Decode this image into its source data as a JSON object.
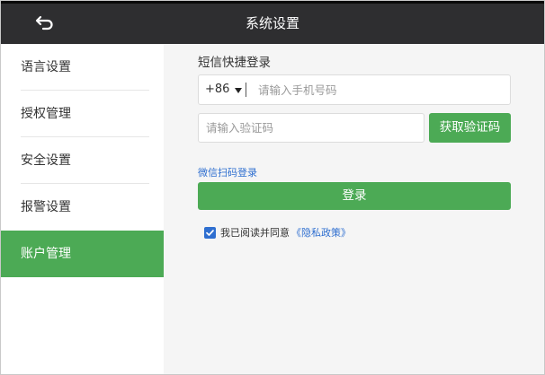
{
  "header": {
    "title": "系统设置",
    "back_icon": "back-arrow-icon",
    "background": "#2e2e30"
  },
  "sidebar": {
    "items": [
      {
        "label": "语言设置",
        "active": false
      },
      {
        "label": "授权管理",
        "active": false
      },
      {
        "label": "安全设置",
        "active": false
      },
      {
        "label": "报警设置",
        "active": false
      },
      {
        "label": "账户管理",
        "active": true
      }
    ],
    "active_color": "#4caa55"
  },
  "login": {
    "section_title": "短信快捷登录",
    "country_code": "+86",
    "phone_placeholder": "请输入手机号码",
    "code_placeholder": "请输入验证码",
    "get_code_label": "获取验证码",
    "wechat_link": "微信扫码登录",
    "submit_label": "登录",
    "agree_text": "我已阅读并同意",
    "policy_link": "《隐私政策》",
    "agree_checked": true
  },
  "colors": {
    "accent": "#4caa55",
    "link": "#2f6fd0",
    "content_background": "#f5f5f5"
  }
}
